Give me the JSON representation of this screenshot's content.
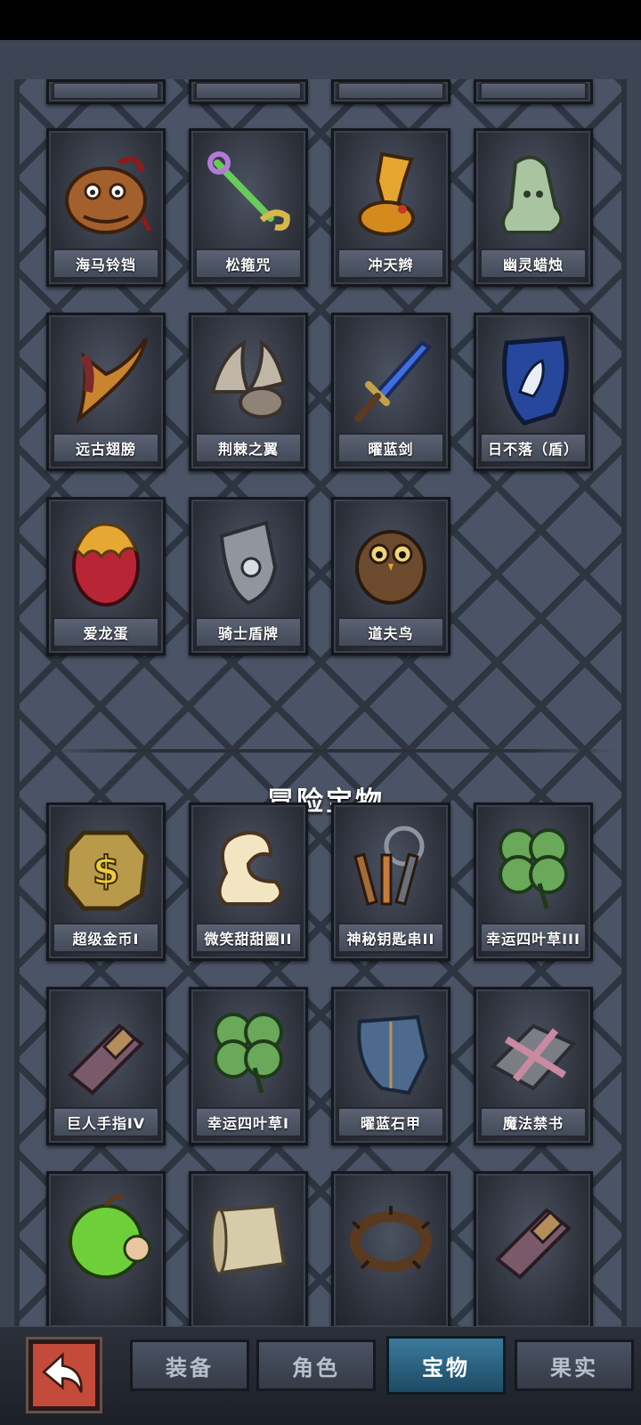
{
  "items": [
    {
      "label": "海马铃铛",
      "icon": "bell-icon"
    },
    {
      "label": "松箍咒",
      "icon": "wand-icon"
    },
    {
      "label": "冲天辫",
      "icon": "hair-tuft-icon"
    },
    {
      "label": "幽灵蜡烛",
      "icon": "ghost-candle-icon"
    },
    {
      "label": "远古翅膀",
      "icon": "wing-icon"
    },
    {
      "label": "荆棘之翼",
      "icon": "thorn-wings-icon"
    },
    {
      "label": "曜蓝剑",
      "icon": "blue-sword-icon"
    },
    {
      "label": "日不落（盾）",
      "icon": "shield-icon"
    },
    {
      "label": "爱龙蛋",
      "icon": "dragon-egg-icon"
    },
    {
      "label": "骑士盾牌",
      "icon": "knight-shield-icon"
    },
    {
      "label": "道夫鸟",
      "icon": "owl-icon"
    }
  ],
  "adventure_section": {
    "title": "冒险宝物",
    "items": [
      {
        "label": "超级金币I",
        "icon": "gold-coin-icon"
      },
      {
        "label": "微笑甜甜圈II",
        "icon": "donut-icon"
      },
      {
        "label": "神秘钥匙串II",
        "icon": "keys-icon"
      },
      {
        "label": "幸运四叶草III",
        "icon": "clover-icon"
      },
      {
        "label": "巨人手指IV",
        "icon": "giant-finger-icon"
      },
      {
        "label": "幸运四叶草I",
        "icon": "clover-icon"
      },
      {
        "label": "曜蓝石甲",
        "icon": "armor-icon"
      },
      {
        "label": "魔法禁书",
        "icon": "forbidden-book-icon"
      },
      {
        "label": "",
        "icon": "apple-icon"
      },
      {
        "label": "",
        "icon": "scroll-icon"
      },
      {
        "label": "",
        "icon": "thorn-ring-icon"
      },
      {
        "label": "",
        "icon": "giant-finger-icon"
      }
    ]
  },
  "tabs": [
    {
      "label": "装备",
      "active": false
    },
    {
      "label": "角色",
      "active": false
    },
    {
      "label": "宝物",
      "active": true
    },
    {
      "label": "果实",
      "active": false
    }
  ],
  "back_button": {
    "icon": "back-arrow-icon"
  }
}
